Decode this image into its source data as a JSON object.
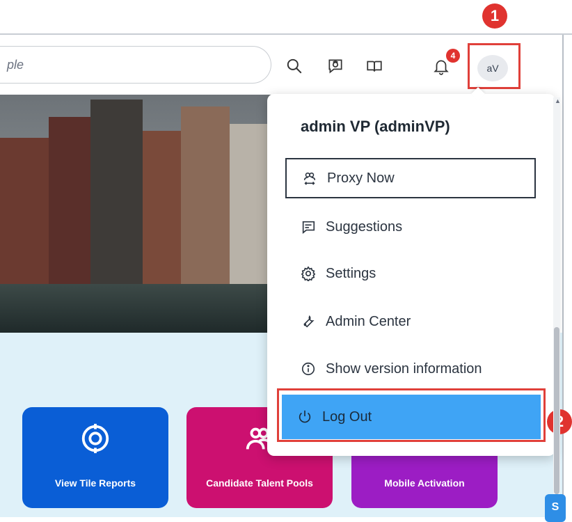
{
  "header": {
    "search_partial_text": "ple",
    "notification_count": "4",
    "avatar_initials": "aV"
  },
  "callouts": {
    "step1": "1",
    "step2": "2"
  },
  "user_menu": {
    "user_name": "admin VP (adminVP)",
    "items": [
      {
        "label": "Proxy Now",
        "icon": "proxy-icon"
      },
      {
        "label": "Suggestions",
        "icon": "suggestions-icon"
      },
      {
        "label": "Settings",
        "icon": "gear-icon"
      },
      {
        "label": "Admin Center",
        "icon": "wrench-icon"
      },
      {
        "label": "Show version information",
        "icon": "info-icon"
      },
      {
        "label": "Log Out",
        "icon": "power-icon"
      }
    ]
  },
  "tiles": [
    {
      "label": "View Tile Reports",
      "color": "#0a5ed6",
      "icon": "target-icon"
    },
    {
      "label": "Candidate Talent Pools",
      "color": "#cc1070",
      "icon": "people-icon"
    },
    {
      "label": "Mobile Activation",
      "color": "#9c1dc4",
      "icon": "mobile-icon"
    }
  ],
  "fab": {
    "label": "S"
  },
  "colors": {
    "highlight_red": "#e0403a",
    "logout_blue": "#3fa4f5",
    "content_bg": "#dff1f9"
  }
}
